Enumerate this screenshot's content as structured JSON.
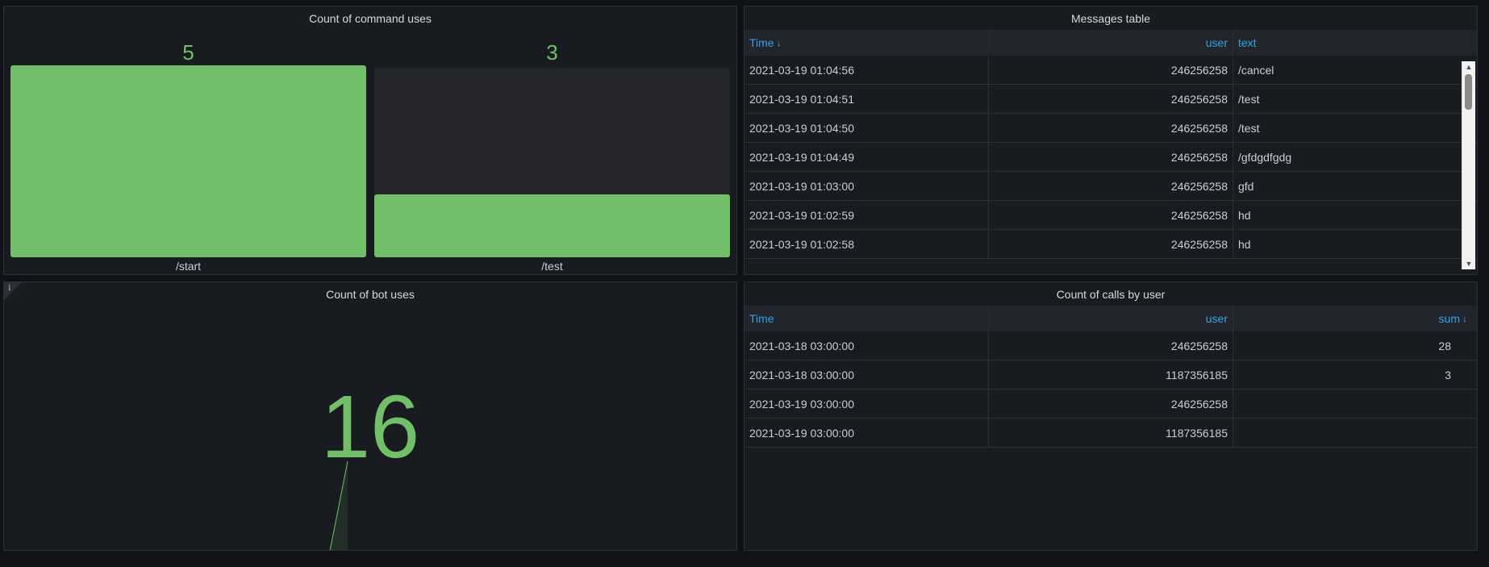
{
  "panels": {
    "commands": {
      "title": "Count of command uses",
      "bars": [
        {
          "label": "/start",
          "value": "5",
          "fraction": 1.0
        },
        {
          "label": "/test",
          "value": "3",
          "fraction": 0.33
        }
      ],
      "color": "#73bf69"
    },
    "messages": {
      "title": "Messages table",
      "columns": [
        {
          "label": "Time",
          "sorted": "desc"
        },
        {
          "label": "user"
        },
        {
          "label": "text"
        }
      ],
      "rows": [
        {
          "time": "2021-03-19 01:04:56",
          "user": "246256258",
          "text": "/cancel"
        },
        {
          "time": "2021-03-19 01:04:51",
          "user": "246256258",
          "text": "/test"
        },
        {
          "time": "2021-03-19 01:04:50",
          "user": "246256258",
          "text": "/test"
        },
        {
          "time": "2021-03-19 01:04:49",
          "user": "246256258",
          "text": "/gfdgdfgdg"
        },
        {
          "time": "2021-03-19 01:03:00",
          "user": "246256258",
          "text": "gfd"
        },
        {
          "time": "2021-03-19 01:02:59",
          "user": "246256258",
          "text": "hd"
        },
        {
          "time": "2021-03-19 01:02:58",
          "user": "246256258",
          "text": "hd"
        }
      ]
    },
    "bot_uses": {
      "title": "Count of bot uses",
      "value": "16",
      "info_icon": "i"
    },
    "calls": {
      "title": "Count of calls by user",
      "columns": [
        {
          "label": "Time"
        },
        {
          "label": "user"
        },
        {
          "label": "sum",
          "sorted": "desc"
        }
      ],
      "rows": [
        {
          "time": "2021-03-18 03:00:00",
          "user": "246256258",
          "sum": "28"
        },
        {
          "time": "2021-03-18 03:00:00",
          "user": "1187356185",
          "sum": "3"
        },
        {
          "time": "2021-03-19 03:00:00",
          "user": "246256258",
          "sum": ""
        },
        {
          "time": "2021-03-19 03:00:00",
          "user": "1187356185",
          "sum": ""
        }
      ]
    }
  },
  "icons": {
    "sort_desc": "sort-desc-arrow-icon",
    "scroll_up": "scroll-up-arrow-icon",
    "scroll_down": "scroll-down-arrow-icon"
  }
}
